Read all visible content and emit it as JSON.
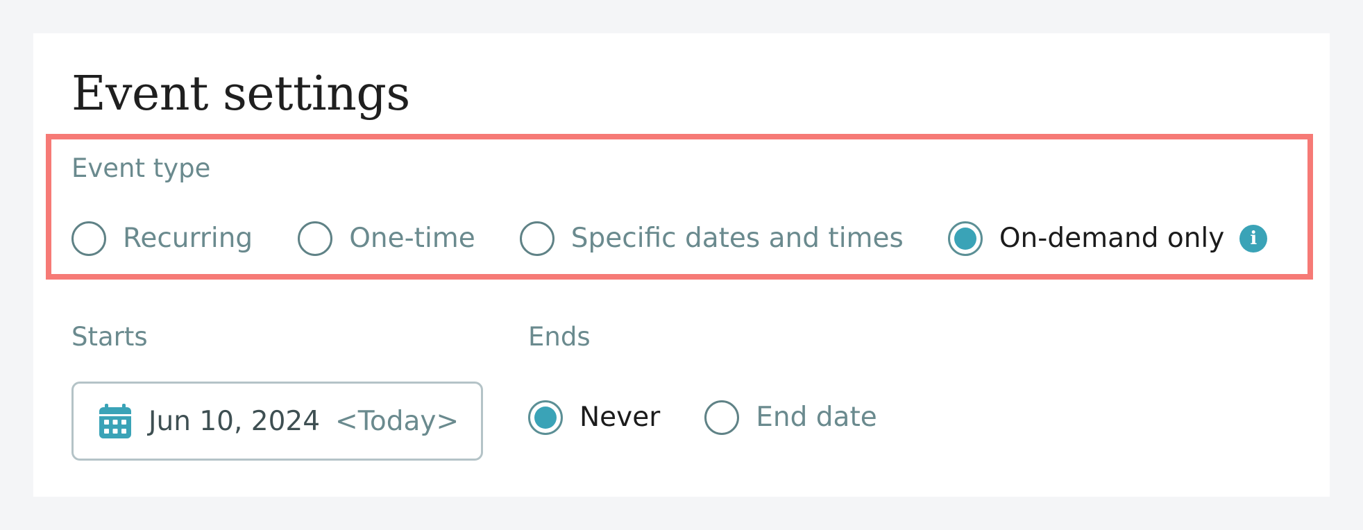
{
  "page": {
    "title": "Event settings"
  },
  "event_type": {
    "label": "Event type",
    "options": [
      {
        "label": "Recurring",
        "selected": false
      },
      {
        "label": "One-time",
        "selected": false
      },
      {
        "label": "Specific dates and times",
        "selected": false
      },
      {
        "label": "On-demand only",
        "selected": true
      }
    ],
    "info_icon": "info-icon"
  },
  "starts": {
    "label": "Starts",
    "date": "Jun 10, 2024",
    "suffix": "<Today>",
    "icon": "calendar-icon"
  },
  "ends": {
    "label": "Ends",
    "options": [
      {
        "label": "Never",
        "selected": true
      },
      {
        "label": "End date",
        "selected": false
      }
    ]
  },
  "colors": {
    "accent": "#3aa3b7",
    "highlight_border": "#f67a76",
    "muted_text": "#6a8a8e",
    "title_text": "#1f1f1f",
    "page_background": "#f4f5f7"
  }
}
